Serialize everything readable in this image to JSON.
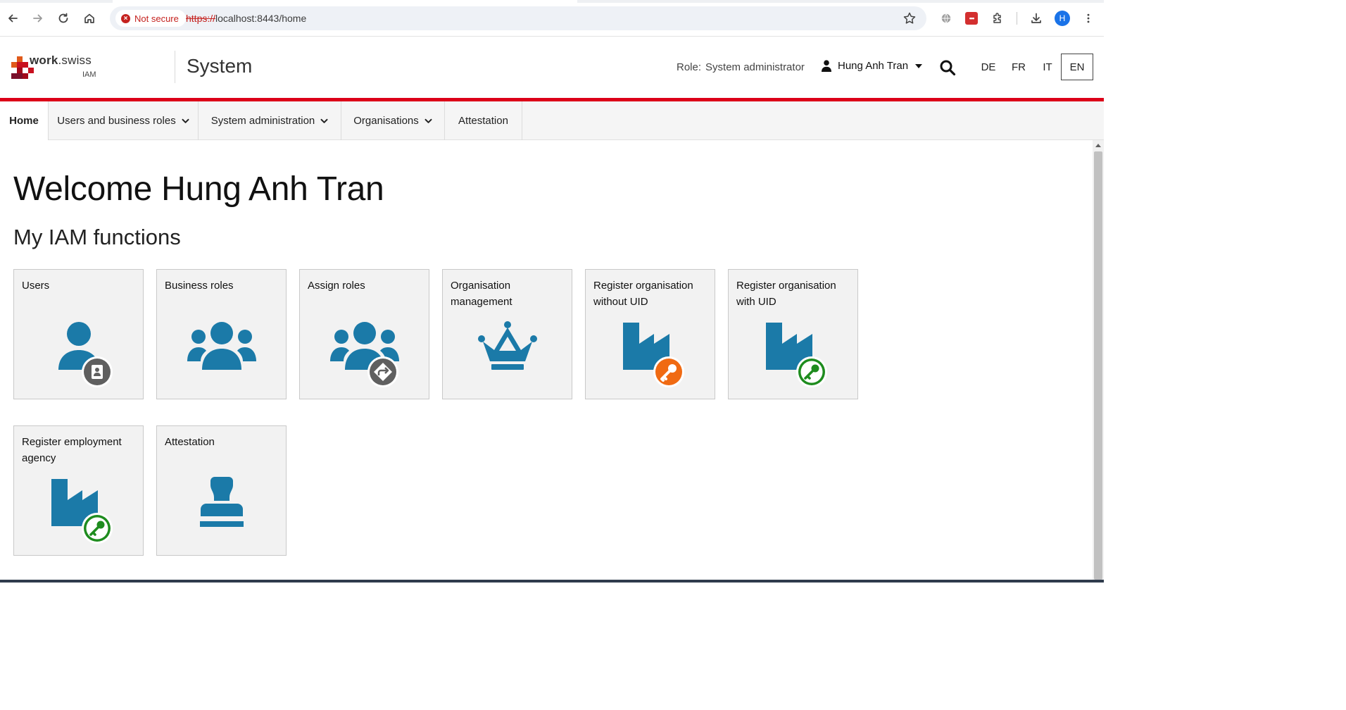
{
  "browser": {
    "security_label": "Not secure",
    "url_scheme": "https://",
    "url_rest": "localhost:8443/home",
    "profile_initial": "H"
  },
  "header": {
    "logo_word_bold": "work",
    "logo_word_rest": ".swiss",
    "logo_sub": "IAM",
    "app_title": "System",
    "role_label": "Role:",
    "role_value": "System administrator",
    "user_name": "Hung Anh Tran",
    "languages": [
      "DE",
      "FR",
      "IT",
      "EN"
    ],
    "active_language": "EN"
  },
  "nav": {
    "items": [
      {
        "label": "Home",
        "dropdown": false
      },
      {
        "label": "Users and business roles",
        "dropdown": true
      },
      {
        "label": "System administration",
        "dropdown": true
      },
      {
        "label": "Organisations",
        "dropdown": true
      },
      {
        "label": "Attestation",
        "dropdown": false
      }
    ]
  },
  "main": {
    "welcome": "Welcome Hung Anh Tran",
    "subtitle": "My IAM functions",
    "tiles": [
      {
        "label": "Users",
        "icon": "user-badge-icon"
      },
      {
        "label": "Business roles",
        "icon": "group-icon"
      },
      {
        "label": "Assign roles",
        "icon": "group-assign-icon"
      },
      {
        "label": "Organisation management",
        "icon": "crown-icon"
      },
      {
        "label": "Register organisation without UID",
        "icon": "factory-orange-key-icon"
      },
      {
        "label": "Register organisation with UID",
        "icon": "factory-green-key-icon"
      },
      {
        "label": "Register employment agency",
        "icon": "factory-green-key-icon"
      },
      {
        "label": "Attestation",
        "icon": "stamp-icon"
      }
    ]
  },
  "colors": {
    "accent_red": "#dc0018",
    "icon_blue": "#1b7aa8",
    "badge_grey": "#5f5f5f",
    "badge_orange": "#f06a12",
    "badge_green": "#1e8c1e"
  }
}
